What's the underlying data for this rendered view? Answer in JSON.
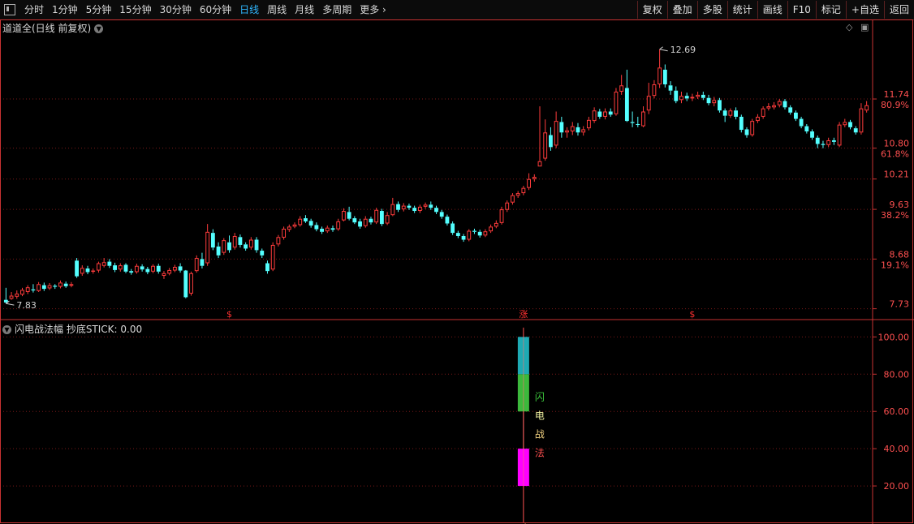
{
  "toolbar": {
    "periods": [
      "分时",
      "1分钟",
      "5分钟",
      "15分钟",
      "30分钟",
      "60分钟",
      "日线",
      "周线",
      "月线",
      "多周期",
      "更多"
    ],
    "active_period": "日线",
    "buttons": [
      "复权",
      "叠加",
      "多股",
      "统计",
      "画线",
      "F10",
      "标记",
      "+自选",
      "返回"
    ],
    "more_icon": "chevron-right-icon"
  },
  "main_panel": {
    "title": "道道全(日线 前复权)",
    "controls": [
      "diamond-icon",
      "window-restore-icon"
    ]
  },
  "sub_panel": {
    "title": "闪电战法幅  抄底STICK: 0.00"
  },
  "chart_data": [
    {
      "type": "candlestick",
      "title": "道道全(日线 前复权)",
      "ylim": [
        7.6,
        12.95
      ],
      "y_ticks": [
        {
          "value": 11.74,
          "label": "11.74",
          "pct": "80.9%"
        },
        {
          "value": 10.8,
          "label": "10.80",
          "pct": "61.8%"
        },
        {
          "value": 10.21,
          "label": "10.21"
        },
        {
          "value": 9.63,
          "label": "9.63",
          "pct": "38.2%"
        },
        {
          "value": 8.68,
          "label": "8.68",
          "pct": "19.1%"
        },
        {
          "value": 7.73,
          "label": "7.73"
        }
      ],
      "high_label": "12.69",
      "low_label": "7.83",
      "bottom_markers": [
        {
          "index": 41,
          "text": "$"
        },
        {
          "index": 95,
          "text": "涨"
        },
        {
          "index": 126,
          "text": "$"
        }
      ],
      "colors": {
        "up": "#ff3c3c",
        "down": "#54ffff",
        "grid": "#7a1818",
        "axis": "#c83232",
        "label": "#ff5050"
      },
      "candles": [
        [
          7.9,
          7.85,
          8.13,
          7.83
        ],
        [
          7.92,
          7.98,
          8.05,
          7.9
        ],
        [
          7.96,
          8.02,
          8.08,
          7.92
        ],
        [
          8.0,
          8.09,
          8.13,
          7.97
        ],
        [
          8.05,
          8.14,
          8.18,
          8.01
        ],
        [
          8.1,
          8.08,
          8.2,
          8.04
        ],
        [
          8.07,
          8.2,
          8.24,
          8.05
        ],
        [
          8.18,
          8.11,
          8.23,
          8.07
        ],
        [
          8.12,
          8.18,
          8.22,
          8.09
        ],
        [
          8.17,
          8.15,
          8.2,
          8.11
        ],
        [
          8.15,
          8.23,
          8.27,
          8.12
        ],
        [
          8.21,
          8.16,
          8.25,
          8.13
        ],
        [
          8.17,
          8.2,
          8.24,
          8.14
        ],
        [
          8.65,
          8.35,
          8.7,
          8.32
        ],
        [
          8.4,
          8.51,
          8.56,
          8.36
        ],
        [
          8.5,
          8.43,
          8.55,
          8.39
        ],
        [
          8.44,
          8.46,
          8.5,
          8.4
        ],
        [
          8.46,
          8.6,
          8.63,
          8.42
        ],
        [
          8.55,
          8.62,
          8.7,
          8.52
        ],
        [
          8.63,
          8.55,
          8.68,
          8.51
        ],
        [
          8.56,
          8.47,
          8.61,
          8.43
        ],
        [
          8.48,
          8.56,
          8.6,
          8.44
        ],
        [
          8.57,
          8.44,
          8.6,
          8.41
        ],
        [
          8.45,
          8.42,
          8.49,
          8.38
        ],
        [
          8.43,
          8.55,
          8.59,
          8.4
        ],
        [
          8.54,
          8.48,
          8.58,
          8.44
        ],
        [
          8.49,
          8.43,
          8.53,
          8.39
        ],
        [
          8.44,
          8.55,
          8.58,
          8.41
        ],
        [
          8.55,
          8.44,
          8.59,
          8.4
        ],
        [
          8.36,
          8.41,
          8.45,
          8.3
        ],
        [
          8.4,
          8.47,
          8.51,
          8.37
        ],
        [
          8.46,
          8.53,
          8.57,
          8.43
        ],
        [
          8.54,
          8.46,
          8.6,
          8.42
        ],
        [
          8.46,
          7.95,
          8.47,
          7.93
        ],
        [
          8.02,
          8.41,
          8.44,
          7.98
        ],
        [
          8.45,
          8.7,
          8.75,
          8.42
        ],
        [
          8.68,
          8.55,
          8.8,
          8.5
        ],
        [
          8.6,
          9.2,
          9.35,
          8.55
        ],
        [
          9.18,
          8.9,
          9.25,
          8.85
        ],
        [
          8.92,
          8.75,
          9.0,
          8.7
        ],
        [
          8.8,
          9.04,
          9.08,
          8.76
        ],
        [
          9.0,
          8.85,
          9.13,
          8.8
        ],
        [
          8.9,
          9.12,
          9.18,
          8.86
        ],
        [
          9.1,
          8.95,
          9.15,
          8.9
        ],
        [
          8.96,
          8.88,
          9.0,
          8.84
        ],
        [
          8.9,
          9.05,
          9.1,
          8.86
        ],
        [
          9.05,
          8.85,
          9.1,
          8.8
        ],
        [
          8.84,
          8.75,
          8.88,
          8.7
        ],
        [
          8.6,
          8.45,
          8.65,
          8.4
        ],
        [
          8.48,
          8.95,
          9.0,
          8.45
        ],
        [
          8.96,
          9.1,
          9.14,
          8.92
        ],
        [
          9.09,
          9.26,
          9.3,
          9.05
        ],
        [
          9.24,
          9.3,
          9.34,
          9.2
        ],
        [
          9.3,
          9.34,
          9.38,
          9.27
        ],
        [
          9.33,
          9.45,
          9.5,
          9.3
        ],
        [
          9.46,
          9.4,
          9.52,
          9.37
        ],
        [
          9.41,
          9.32,
          9.45,
          9.28
        ],
        [
          9.33,
          9.25,
          9.38,
          9.21
        ],
        [
          9.26,
          9.2,
          9.3,
          9.16
        ],
        [
          9.21,
          9.28,
          9.32,
          9.18
        ],
        [
          9.27,
          9.24,
          9.32,
          9.2
        ],
        [
          9.25,
          9.4,
          9.45,
          9.22
        ],
        [
          9.42,
          9.6,
          9.65,
          9.4
        ],
        [
          9.58,
          9.45,
          9.68,
          9.42
        ],
        [
          9.46,
          9.38,
          9.5,
          9.35
        ],
        [
          9.4,
          9.3,
          9.45,
          9.26
        ],
        [
          9.31,
          9.45,
          9.5,
          9.28
        ],
        [
          9.45,
          9.38,
          9.49,
          9.34
        ],
        [
          9.38,
          9.62,
          9.66,
          9.35
        ],
        [
          9.6,
          9.35,
          9.64,
          9.31
        ],
        [
          9.36,
          9.52,
          9.58,
          9.33
        ],
        [
          9.52,
          9.73,
          9.85,
          9.5
        ],
        [
          9.73,
          9.62,
          9.78,
          9.58
        ],
        [
          9.63,
          9.7,
          9.75,
          9.59
        ],
        [
          9.7,
          9.66,
          9.74,
          9.62
        ],
        [
          9.66,
          9.6,
          9.7,
          9.56
        ],
        [
          9.6,
          9.68,
          9.72,
          9.56
        ],
        [
          9.68,
          9.72,
          9.76,
          9.64
        ],
        [
          9.72,
          9.66,
          9.78,
          9.62
        ],
        [
          9.66,
          9.58,
          9.7,
          9.54
        ],
        [
          9.58,
          9.49,
          9.62,
          9.45
        ],
        [
          9.49,
          9.36,
          9.53,
          9.32
        ],
        [
          9.36,
          9.18,
          9.4,
          9.14
        ],
        [
          9.18,
          9.12,
          9.22,
          9.08
        ],
        [
          9.12,
          9.05,
          9.16,
          9.01
        ],
        [
          9.05,
          9.22,
          9.25,
          9.02
        ],
        [
          9.22,
          9.2,
          9.26,
          9.16
        ],
        [
          9.2,
          9.13,
          9.24,
          9.09
        ],
        [
          9.13,
          9.21,
          9.25,
          9.1
        ],
        [
          9.21,
          9.3,
          9.34,
          9.18
        ],
        [
          9.3,
          9.37,
          9.42,
          9.27
        ],
        [
          9.37,
          9.63,
          9.68,
          9.34
        ],
        [
          9.62,
          9.76,
          9.8,
          9.58
        ],
        [
          9.76,
          9.9,
          9.94,
          9.72
        ],
        [
          9.89,
          9.94,
          9.98,
          9.85
        ],
        [
          9.94,
          10.04,
          10.08,
          9.9
        ],
        [
          10.04,
          10.21,
          10.32,
          10.0
        ],
        [
          10.21,
          10.25,
          10.3,
          10.16
        ],
        [
          10.45,
          10.55,
          11.6,
          10.45
        ],
        [
          10.6,
          11.1,
          11.35,
          10.56
        ],
        [
          11.05,
          10.82,
          11.2,
          10.75
        ],
        [
          10.85,
          11.32,
          11.5,
          10.8
        ],
        [
          11.3,
          11.1,
          11.4,
          11.0
        ],
        [
          11.1,
          11.14,
          11.2,
          11.0
        ],
        [
          11.12,
          11.22,
          11.3,
          11.05
        ],
        [
          11.2,
          11.1,
          11.28,
          11.04
        ],
        [
          11.1,
          11.16,
          11.22,
          11.04
        ],
        [
          11.18,
          11.34,
          11.4,
          11.14
        ],
        [
          11.32,
          11.52,
          11.58,
          11.28
        ],
        [
          11.5,
          11.4,
          11.55,
          11.36
        ],
        [
          11.4,
          11.5,
          11.56,
          11.35
        ],
        [
          11.5,
          11.44,
          11.56,
          11.4
        ],
        [
          11.45,
          11.88,
          11.95,
          11.42
        ],
        [
          11.88,
          12.0,
          12.2,
          11.82
        ],
        [
          11.95,
          11.32,
          12.3,
          11.3
        ],
        [
          11.3,
          11.28,
          11.5,
          11.2
        ],
        [
          11.26,
          11.25,
          11.4,
          11.2
        ],
        [
          11.22,
          11.5,
          11.6,
          11.2
        ],
        [
          11.52,
          11.8,
          12.05,
          11.45
        ],
        [
          11.8,
          12.02,
          12.1,
          11.75
        ],
        [
          12.02,
          12.34,
          12.69,
          11.95
        ],
        [
          12.3,
          12.02,
          12.4,
          11.96
        ],
        [
          12.0,
          11.9,
          12.08,
          11.82
        ],
        [
          11.9,
          11.7,
          11.98,
          11.66
        ],
        [
          11.72,
          11.8,
          11.88,
          11.66
        ],
        [
          11.8,
          11.75,
          11.86,
          11.7
        ],
        [
          11.75,
          11.78,
          11.84,
          11.7
        ],
        [
          11.78,
          11.82,
          11.88,
          11.74
        ],
        [
          11.82,
          11.76,
          11.88,
          11.72
        ],
        [
          11.76,
          11.66,
          11.82,
          11.62
        ],
        [
          11.66,
          11.72,
          11.78,
          11.6
        ],
        [
          11.72,
          11.52,
          11.76,
          11.48
        ],
        [
          11.52,
          11.42,
          11.56,
          11.3
        ],
        [
          11.42,
          11.52,
          11.56,
          11.38
        ],
        [
          11.52,
          11.4,
          11.58,
          11.35
        ],
        [
          11.4,
          11.15,
          11.44,
          11.1
        ],
        [
          11.16,
          11.05,
          11.2,
          11.0
        ],
        [
          11.05,
          11.32,
          11.36,
          11.02
        ],
        [
          11.32,
          11.4,
          11.45,
          11.28
        ],
        [
          11.4,
          11.56,
          11.6,
          11.36
        ],
        [
          11.56,
          11.6,
          11.66,
          11.52
        ],
        [
          11.58,
          11.62,
          11.68,
          11.54
        ],
        [
          11.62,
          11.7,
          11.74,
          11.58
        ],
        [
          11.7,
          11.58,
          11.74,
          11.54
        ],
        [
          11.58,
          11.48,
          11.62,
          11.44
        ],
        [
          11.48,
          11.36,
          11.52,
          11.32
        ],
        [
          11.36,
          11.22,
          11.4,
          11.18
        ],
        [
          11.22,
          11.12,
          11.26,
          11.08
        ],
        [
          11.12,
          11.0,
          11.16,
          10.96
        ],
        [
          11.0,
          10.88,
          11.04,
          10.8
        ],
        [
          10.88,
          10.86,
          10.94,
          10.8
        ],
        [
          10.86,
          10.95,
          11.0,
          10.82
        ],
        [
          10.95,
          10.92,
          11.0,
          10.86
        ],
        [
          10.85,
          11.25,
          11.3,
          10.82
        ],
        [
          11.24,
          11.3,
          11.36,
          11.2
        ],
        [
          11.3,
          11.2,
          11.34,
          11.16
        ],
        [
          11.18,
          11.1,
          11.22,
          11.06
        ],
        [
          11.1,
          11.56,
          11.66,
          11.06
        ],
        [
          11.52,
          11.62,
          11.7,
          11.48
        ]
      ]
    },
    {
      "type": "bar",
      "title": "闪电战法幅  抄底STICK: 0.00",
      "ylim": [
        0,
        108
      ],
      "y_ticks": [
        {
          "value": 100,
          "label": "100.00"
        },
        {
          "value": 80,
          "label": "80.00"
        },
        {
          "value": 60,
          "label": "60.00"
        },
        {
          "value": 40,
          "label": "40.00"
        },
        {
          "value": 20,
          "label": "20.00"
        }
      ],
      "bars": [
        {
          "from": 20,
          "to": 40,
          "color": "#ff00ff"
        },
        {
          "from": 60,
          "to": 80,
          "color": "#3cb93c"
        },
        {
          "from": 80,
          "to": 100,
          "color": "#1eaab4"
        }
      ],
      "signal_index": 95,
      "vertical_text": [
        {
          "char": "闪",
          "color": "#3cc83c"
        },
        {
          "char": "电",
          "color": "#f0f0a0"
        },
        {
          "char": "战",
          "color": "#f0d080"
        },
        {
          "char": "法",
          "color": "#ff5050"
        }
      ],
      "cursor_icon": "hand-pointer-icon"
    }
  ]
}
